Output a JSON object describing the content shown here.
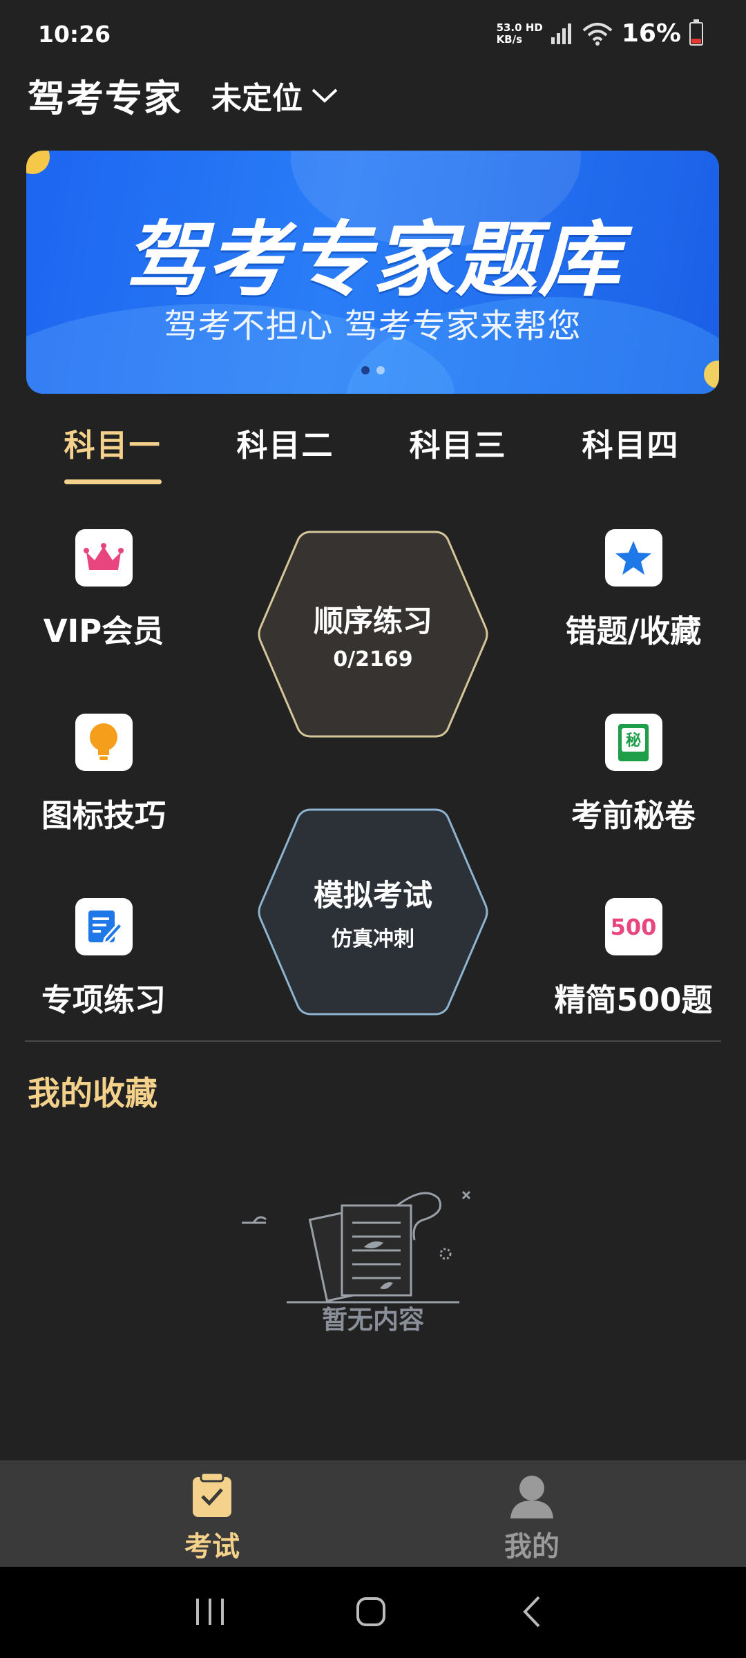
{
  "status_bar": {
    "time": "10:26",
    "net_speed_value": "53.0",
    "net_speed_unit": "KB/s",
    "net_type": "HD",
    "battery": "16%"
  },
  "header": {
    "title": "驾考专家",
    "location": "未定位"
  },
  "banner": {
    "title": "驾考专家题库",
    "subtitle": "驾考不担心 驾考专家来帮您",
    "dots": 2,
    "active_dot": 0
  },
  "tabs": [
    {
      "label": "科目一",
      "active": true
    },
    {
      "label": "科目二",
      "active": false
    },
    {
      "label": "科目三",
      "active": false
    },
    {
      "label": "科目四",
      "active": false
    }
  ],
  "grid": {
    "vip": {
      "label": "VIP会员",
      "icon": "crown-icon"
    },
    "wrong": {
      "label": "错题/收藏",
      "icon": "star-icon"
    },
    "tips": {
      "label": "图标技巧",
      "icon": "lightbulb-icon"
    },
    "secret": {
      "label": "考前秘卷",
      "icon": "secret-book-icon",
      "badge_text": "秘"
    },
    "special": {
      "label": "专项练习",
      "icon": "edit-document-icon"
    },
    "simple500": {
      "label": "精简500题",
      "icon": "500-icon",
      "badge_text": "500"
    }
  },
  "hex_practice": {
    "title": "顺序练习",
    "progress": "0/2169"
  },
  "hex_exam": {
    "title": "模拟考试",
    "subtitle": "仿真冲刺"
  },
  "favorites": {
    "title": "我的收藏",
    "empty_text": "暂无内容"
  },
  "bottom_nav": [
    {
      "label": "考试",
      "icon": "clipboard-check-icon",
      "active": true
    },
    {
      "label": "我的",
      "icon": "person-icon",
      "active": false
    }
  ],
  "colors": {
    "background": "#222222",
    "accent": "#f5d28c",
    "banner_blue": "#1d66f0",
    "nav_bar": "#3a3a3a",
    "vip_pink": "#e8457f",
    "star_blue": "#1f78e8",
    "bulb_orange": "#f59e1b",
    "secret_green": "#1f9e4a"
  }
}
